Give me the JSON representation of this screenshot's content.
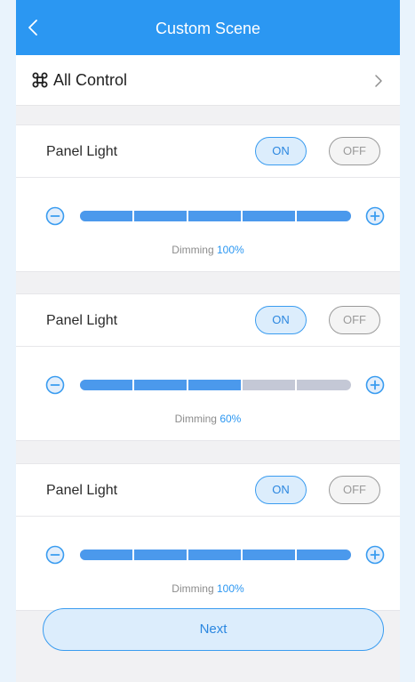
{
  "header": {
    "title": "Custom Scene"
  },
  "all_control": {
    "label": "All Control"
  },
  "cards": [
    {
      "title": "Panel Light",
      "on_label": "ON",
      "off_label": "OFF",
      "dimming_label": "Dimming",
      "dimming_value": "100%",
      "level": 1.0
    },
    {
      "title": "Panel Light",
      "on_label": "ON",
      "off_label": "OFF",
      "dimming_label": "Dimming",
      "dimming_value": "60%",
      "level": 0.6
    },
    {
      "title": "Panel Light",
      "on_label": "ON",
      "off_label": "OFF",
      "dimming_label": "Dimming",
      "dimming_value": "100%",
      "level": 1.0
    }
  ],
  "footer": {
    "next_label": "Next"
  },
  "colors": {
    "accent": "#2b97f2",
    "fill": "#4b99ec",
    "track": "#c4c8d6",
    "off": "#9a9a9a"
  }
}
